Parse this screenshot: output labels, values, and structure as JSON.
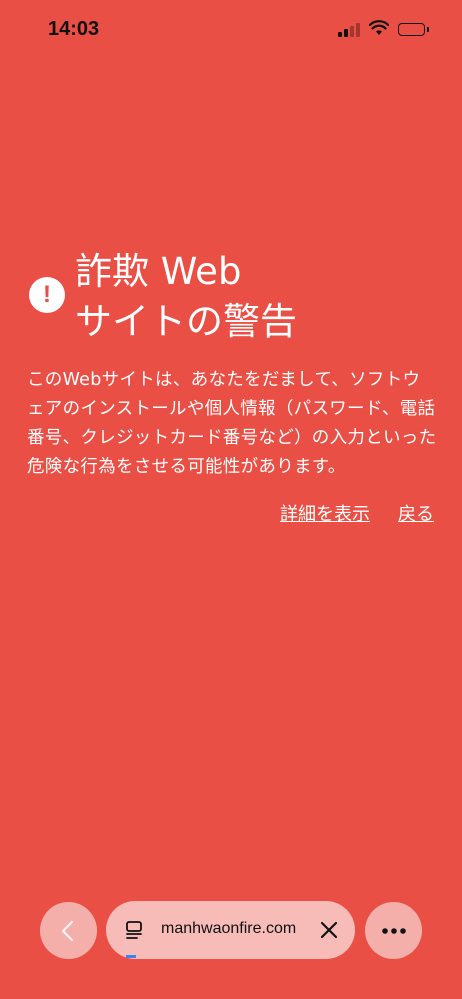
{
  "status_bar": {
    "time": "14:03"
  },
  "warning": {
    "title_line1": "詐欺 Web",
    "title_line2": "サイトの警告",
    "message": "このWebサイトは、あなたをだまして、ソフトウェアのインストールや個人情報（パスワード、電話番号、クレジットカード番号など）の入力といった危険な行為をさせる可能性があります。",
    "details_link": "詳細を表示",
    "back_link": "戻る"
  },
  "browser": {
    "url": "manhwaonfire.com"
  },
  "colors": {
    "background": "#E94F45",
    "text": "#FFFFFF",
    "progress": "#3B82F6"
  },
  "icons": [
    "cellular-signal-icon",
    "wifi-icon",
    "battery-icon",
    "warning-icon",
    "chevron-left-icon",
    "tabs-icon",
    "close-icon",
    "more-icon"
  ]
}
